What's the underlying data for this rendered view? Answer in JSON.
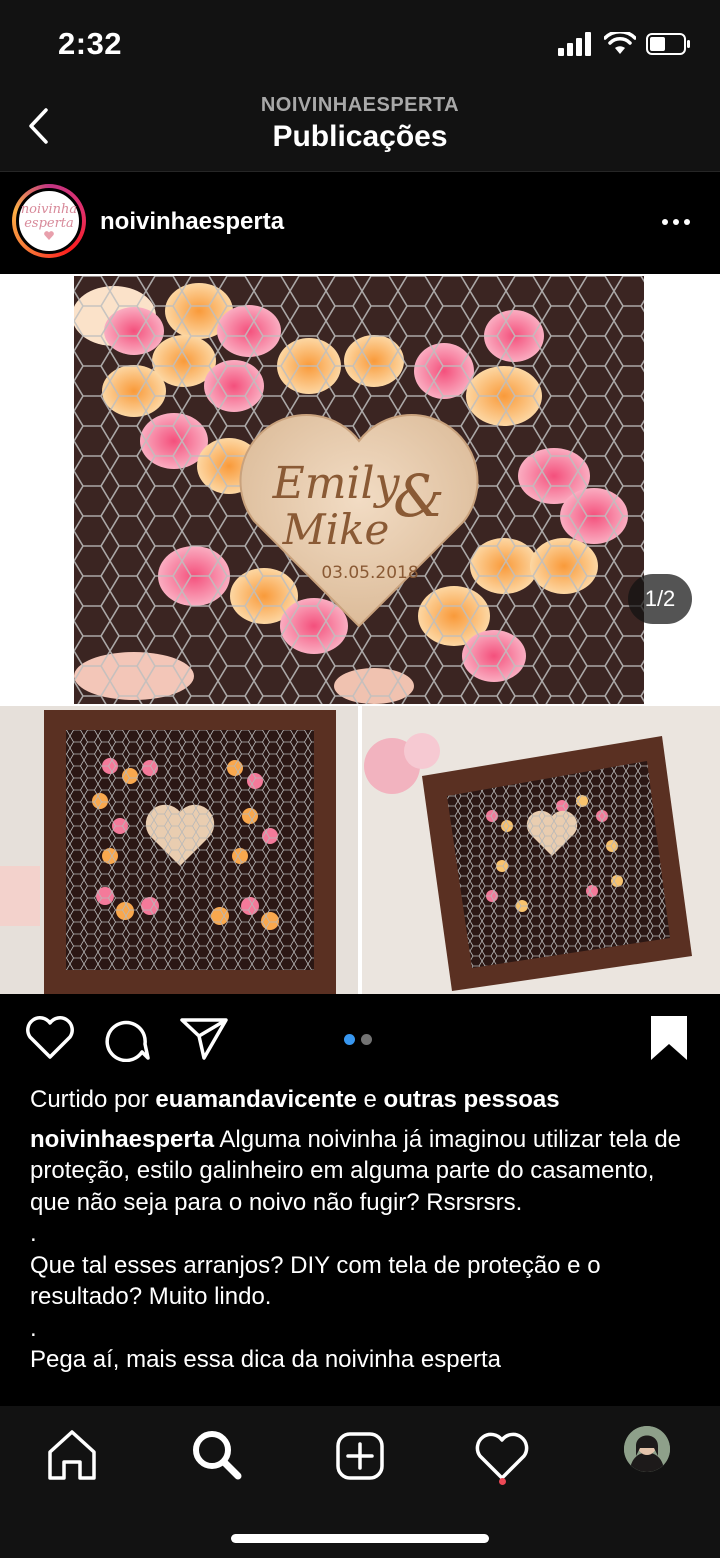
{
  "status_bar": {
    "time": "2:32"
  },
  "header": {
    "account": "NOIVINHAESPERTA",
    "title": "Publicações"
  },
  "post": {
    "username": "noivinhaesperta",
    "avatar_text": "noivinha esperta",
    "page_counter": "1/2",
    "image_text": {
      "names_line1": "Emily",
      "names_amp": "&",
      "names_line2": "Mike",
      "date": "03.05.2018"
    },
    "likes": {
      "prefix": "Curtido por",
      "user": "euamandavicente",
      "middle": "e",
      "others": "outras pessoas"
    },
    "caption": {
      "author": "noivinhaesperta",
      "line1": "Alguma noivinha já imaginou utilizar tela de proteção, estilo galinheiro em alguma parte do casamento, que não seja para o noivo não fugir? Rsrsrsrs.",
      "sep1": ".",
      "line2": "Que tal esses arranjos? DIY com tela de proteção e o resultado? Muito lindo.",
      "sep2": ".",
      "line3": "Pega aí, mais essa dica da noivinha esperta"
    },
    "carousel": {
      "current": 1,
      "total": 2
    }
  },
  "colors": {
    "background": "#000000",
    "bar": "#121212",
    "active_dot": "#3897f0",
    "inactive_dot": "#737373",
    "notification": "#ed4956"
  },
  "icons": {
    "back": "chevron-left-icon",
    "more": "more-horizontal-icon",
    "like": "heart-icon",
    "comment": "comment-icon",
    "share": "paper-plane-icon",
    "save": "bookmark-icon",
    "home": "home-icon",
    "search": "search-icon",
    "new_post": "plus-square-icon",
    "activity": "heart-icon",
    "profile": "profile-avatar"
  }
}
